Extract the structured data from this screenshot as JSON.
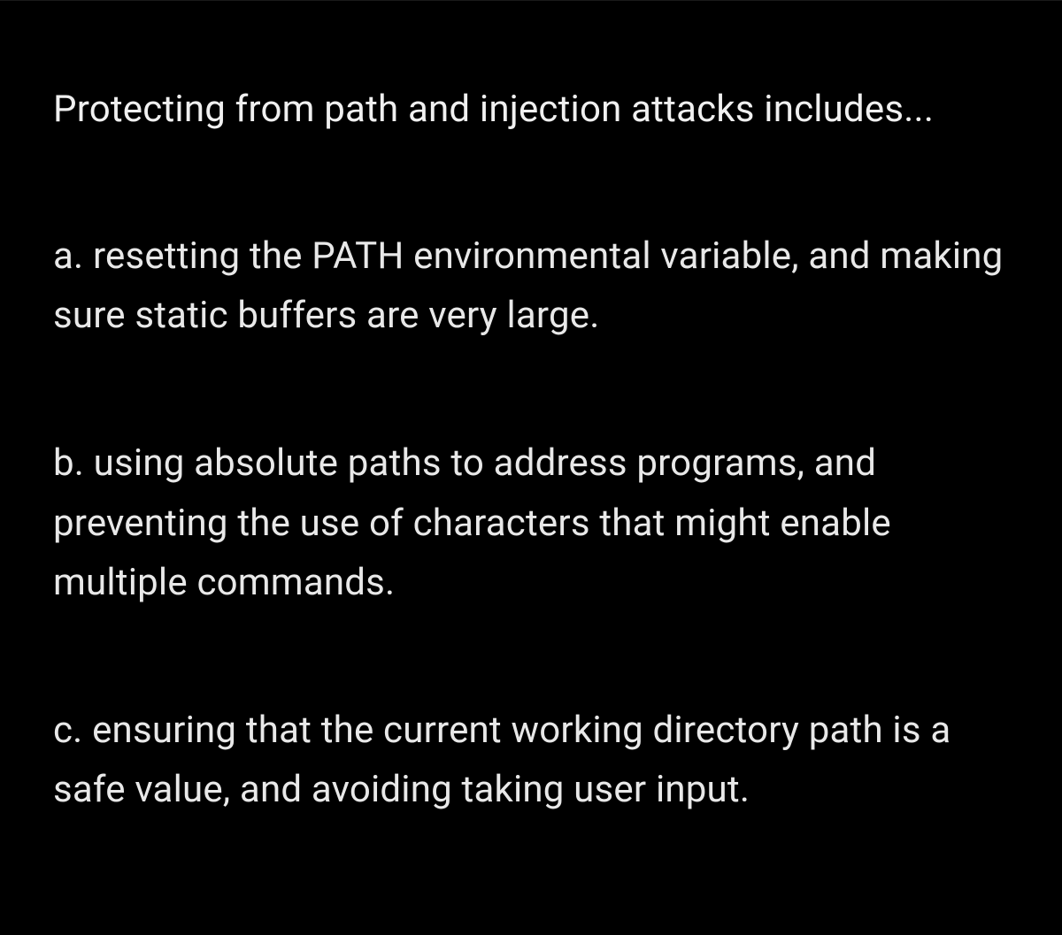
{
  "question": "Protecting from path and injection attacks includes...",
  "options": [
    {
      "label": "a.",
      "text": "a. resetting the PATH environmental variable, and making sure static buffers are very large."
    },
    {
      "label": "b.",
      "text": "b. using absolute paths to address programs, and preventing the use of characters that might enable multiple commands."
    },
    {
      "label": "c.",
      "text": "c. ensuring that the current working directory path is a safe value, and avoiding taking user input."
    }
  ]
}
